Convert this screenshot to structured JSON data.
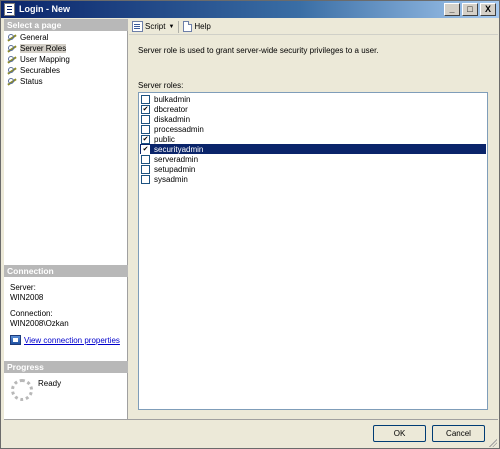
{
  "window": {
    "title": "Login - New",
    "controls": {
      "minimize": "_",
      "maximize": "□",
      "close": "X"
    }
  },
  "left_pane": {
    "select_page_header": "Select a page",
    "pages": [
      {
        "label": "General",
        "icon": "wrench-icon",
        "selected": false
      },
      {
        "label": "Server Roles",
        "icon": "wrench-icon",
        "selected": true
      },
      {
        "label": "User Mapping",
        "icon": "wrench-icon",
        "selected": false
      },
      {
        "label": "Securables",
        "icon": "wrench-icon",
        "selected": false
      },
      {
        "label": "Status",
        "icon": "wrench-icon",
        "selected": false
      }
    ],
    "connection": {
      "header": "Connection",
      "server_label": "Server:",
      "server_value": "WIN2008",
      "connection_label": "Connection:",
      "connection_value": "WIN2008\\Ozkan",
      "view_props_link": "View connection properties"
    },
    "progress": {
      "header": "Progress",
      "status": "Ready"
    }
  },
  "toolbar": {
    "script_label": "Script",
    "help_label": "Help"
  },
  "main": {
    "description": "Server role is used to grant server-wide security privileges to a user.",
    "roles_label": "Server roles:",
    "roles": [
      {
        "name": "bulkadmin",
        "checked": false,
        "selected": false
      },
      {
        "name": "dbcreator",
        "checked": true,
        "selected": false
      },
      {
        "name": "diskadmin",
        "checked": false,
        "selected": false
      },
      {
        "name": "processadmin",
        "checked": false,
        "selected": false
      },
      {
        "name": "public",
        "checked": true,
        "selected": false
      },
      {
        "name": "securityadmin",
        "checked": true,
        "selected": true
      },
      {
        "name": "serveradmin",
        "checked": false,
        "selected": false
      },
      {
        "name": "setupadmin",
        "checked": false,
        "selected": false
      },
      {
        "name": "sysadmin",
        "checked": false,
        "selected": false
      }
    ]
  },
  "buttons": {
    "ok": "OK",
    "cancel": "Cancel"
  },
  "colors": {
    "selection": "#0a246a",
    "link": "#0000cc",
    "section_header": "#b8b8b8"
  }
}
